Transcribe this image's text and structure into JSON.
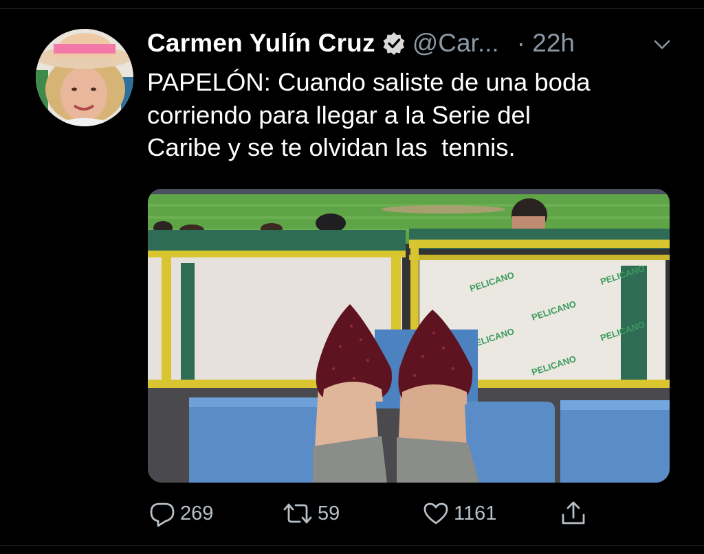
{
  "tweet": {
    "author": {
      "name": "Carmen Yulín Cruz",
      "handle": "@Car...",
      "verified_icon": "verified-badge-icon",
      "avatar": "avatar"
    },
    "time": "· 22h",
    "text_lines": [
      "PAPELÓN: Cuando saliste de una boda",
      "corriendo para llegar a la Serie del",
      "Caribe y se te olvidan las  tennis."
    ],
    "media": {
      "sign_text": "PELICANO"
    },
    "actions": {
      "reply": {
        "icon": "reply-icon",
        "count": "269"
      },
      "retweet": {
        "icon": "retweet-icon",
        "count": "59"
      },
      "like": {
        "icon": "heart-icon",
        "count": "1161"
      },
      "share": {
        "icon": "share-icon"
      }
    },
    "colors": {
      "background": "#000000",
      "secondary_text": "#8b98a5",
      "accent": "#ffffff"
    }
  }
}
